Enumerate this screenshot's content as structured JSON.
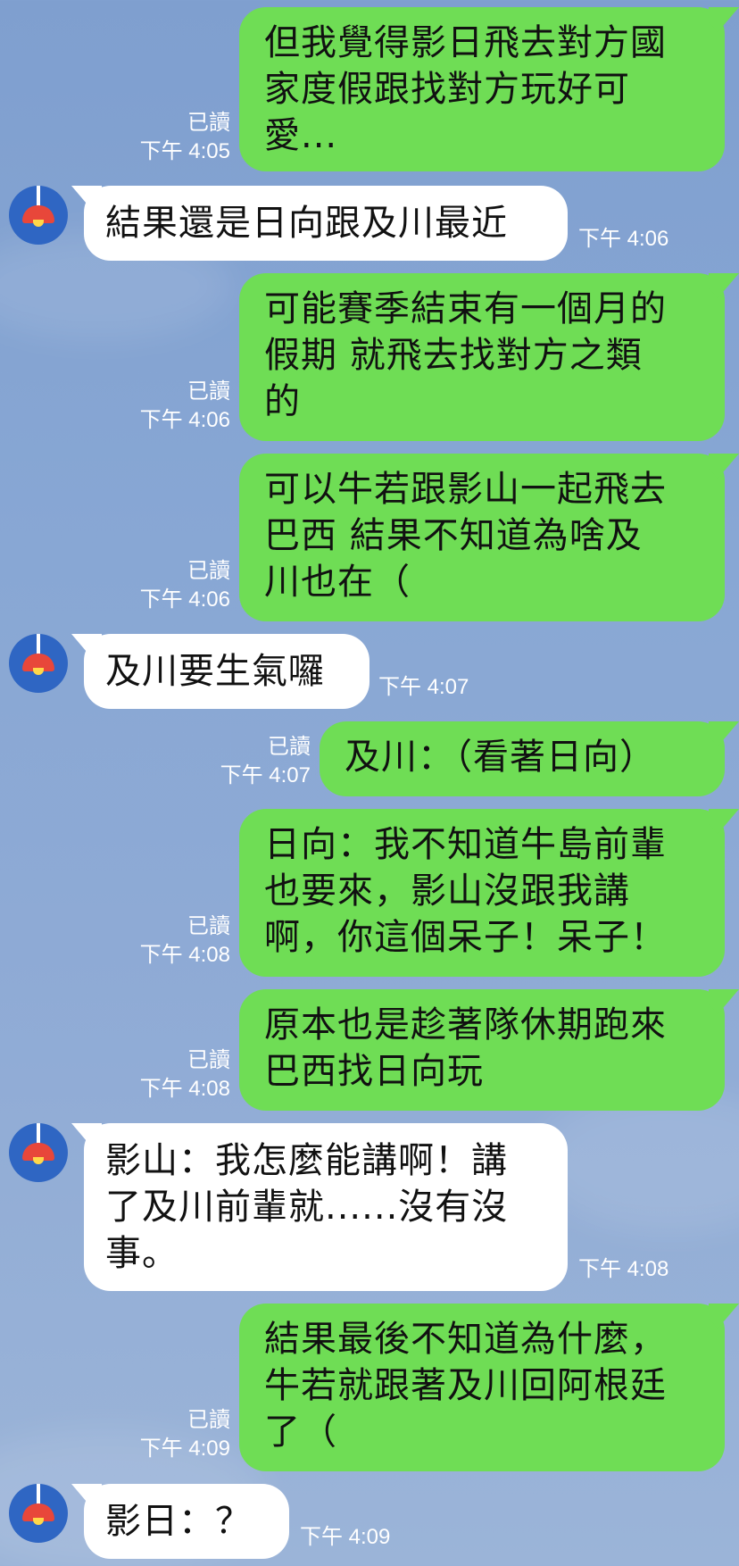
{
  "chat": {
    "messages": [
      {
        "side": "sent",
        "text": "但我覺得影日飛去對方國\n家度假跟找對方玩好可\n愛...",
        "read": "已讀",
        "time": "下午 4:05"
      },
      {
        "side": "recv",
        "text": "結果還是日向跟及川最近",
        "time": "下午 4:06"
      },
      {
        "side": "sent",
        "text": "可能賽季結束有一個月的\n假期 就飛去找對方之類\n的",
        "read": "已讀",
        "time": "下午 4:06"
      },
      {
        "side": "sent",
        "text": "可以牛若跟影山一起飛去\n巴西 結果不知道為啥及\n川也在（",
        "read": "已讀",
        "time": "下午 4:06"
      },
      {
        "side": "recv",
        "text": "及川要生氣囉",
        "time": "下午 4:07"
      },
      {
        "side": "sent",
        "text": "及川：（看著日向）",
        "read": "已讀",
        "time": "下午 4:07"
      },
      {
        "side": "sent",
        "text": "日向：我不知道牛島前輩\n也要來，影山沒跟我講\n啊，你這個呆子！呆子！",
        "read": "已讀",
        "time": "下午 4:08"
      },
      {
        "side": "sent",
        "text": "原本也是趁著隊休期跑來\n巴西找日向玩",
        "read": "已讀",
        "time": "下午 4:08"
      },
      {
        "side": "recv",
        "text": "影山：我怎麼能講啊！講\n了及川前輩就......沒有沒\n事。",
        "time": "下午 4:08"
      },
      {
        "side": "sent",
        "text": "結果最後不知道為什麼，\n牛若就跟著及川回阿根廷\n了（",
        "read": "已讀",
        "time": "下午 4:09"
      },
      {
        "side": "recv",
        "text": "影日：？",
        "time": "下午 4:09"
      }
    ]
  },
  "colors": {
    "sent_bubble": "#6fdd55",
    "recv_bubble": "#ffffff",
    "avatar_bg": "#2f66c3",
    "lamp": "#e8473a"
  },
  "icons": {
    "avatar": "lamp-icon"
  }
}
